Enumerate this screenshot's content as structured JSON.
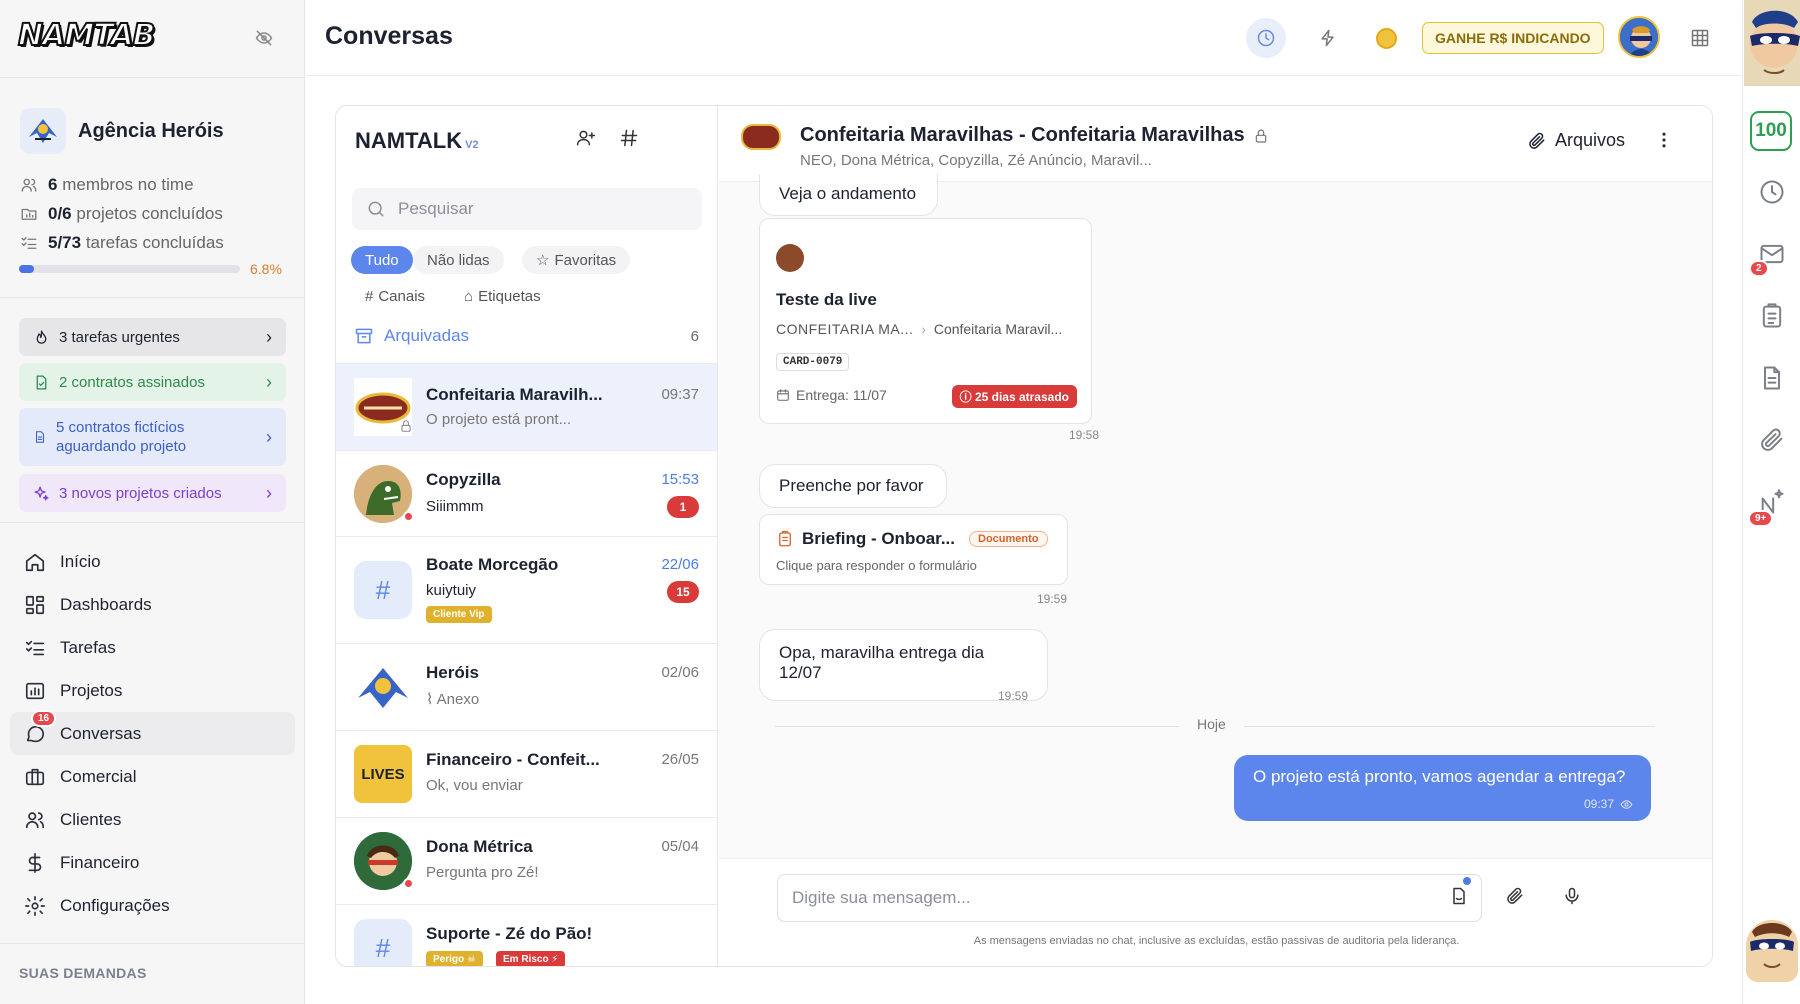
{
  "app": {
    "logo": "NAMTAB"
  },
  "sidebar": {
    "agency_name": "Agência Heróis",
    "stats": [
      {
        "value": "6",
        "label": "membros no time"
      },
      {
        "value": "0/6",
        "label": "projetos concluídos"
      },
      {
        "value": "5/73",
        "label": "tarefas concluídas"
      }
    ],
    "progress": {
      "fraction": 0.068,
      "label": "6.8%"
    },
    "alerts": {
      "urgent": "3 tarefas urgentes",
      "signed": "2 contratos assinados",
      "fake": "5 contratos fictícios aguardando projeto",
      "new_projects": "3 novos projetos criados"
    },
    "nav": [
      {
        "label": "Início"
      },
      {
        "label": "Dashboards"
      },
      {
        "label": "Tarefas"
      },
      {
        "label": "Projetos"
      },
      {
        "label": "Conversas",
        "badge": "16"
      },
      {
        "label": "Comercial"
      },
      {
        "label": "Clientes"
      },
      {
        "label": "Financeiro"
      },
      {
        "label": "Configurações"
      }
    ],
    "section_label": "SUAS DEMANDAS"
  },
  "header": {
    "title": "Conversas",
    "referral": "GANHE R$ INDICANDO"
  },
  "rail": {
    "score": "100",
    "mail_badge": "2",
    "ai_badge": "9+"
  },
  "list": {
    "brand": "NAMTALK",
    "brand_version": "V2",
    "search_placeholder": "Pesquisar",
    "filters": {
      "all": "Tudo",
      "unread": "Não lidas",
      "favorites": "Favoritas",
      "channels": "Canais",
      "labels": "Etiquetas"
    },
    "archived": {
      "label": "Arquivadas",
      "count": "6"
    },
    "conversations": [
      {
        "name": "Confeitaria Maravilh...",
        "preview": "O projeto está pront...",
        "time": "09:37"
      },
      {
        "name": "Copyzilla",
        "preview": "Siiimmm",
        "time": "15:53",
        "unread": "1"
      },
      {
        "name": "Boate Morcegão",
        "preview": "kuiytuiy",
        "time": "22/06",
        "unread": "15",
        "tag": "Cliente Vip"
      },
      {
        "name": "Heróis",
        "preview": "Anexo",
        "time": "02/06"
      },
      {
        "name": "Financeiro - Confeit...",
        "preview": "Ok, vou enviar",
        "time": "26/05",
        "avatar_text": "LIVES"
      },
      {
        "name": "Dona Métrica",
        "preview": "Pergunta pro Zé!",
        "time": "05/04"
      },
      {
        "name": "Suporte - Zé do Pão!",
        "tags": [
          "Perigo ☠",
          "Em Risco ⚡"
        ]
      }
    ]
  },
  "chat": {
    "title": "Confeitaria Maravilhas - Confeitaria Maravilhas",
    "members": "NEO, Dona Métrica, Copyzilla, Zé Anúncio, Maravil...",
    "files": "Arquivos",
    "messages": {
      "m1": "Veja o andamento",
      "card": {
        "title": "Teste da live",
        "crumb_a": "CONFEITARIA MA...",
        "crumb_b": "Confeitaria Maravil...",
        "id": "CARD-0079",
        "due": "Entrega: 11/07",
        "overdue": "25 dias atrasado",
        "time": "19:58"
      },
      "m2": "Preenche por favor",
      "doc": {
        "title": "Briefing - Onboar...",
        "badge": "Documento",
        "hint": "Clique para responder o formulário",
        "time": "19:59"
      },
      "m3": {
        "text": "Opa, maravilha entrega dia 12/07",
        "time": "19:59"
      },
      "day_divider": "Hoje",
      "mine": {
        "text": "O projeto está pronto, vamos agendar a entrega?",
        "time": "09:37"
      }
    },
    "composer": {
      "placeholder": "Digite sua mensagem...",
      "notice": "As mensagens enviadas no chat, inclusive as excluídas, estão passivas de auditoria pela liderança."
    }
  }
}
